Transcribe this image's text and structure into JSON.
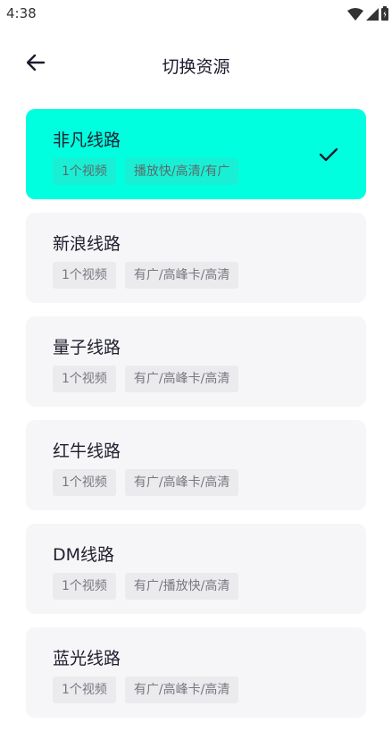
{
  "status_bar": {
    "time": "4:38",
    "icons": [
      "wifi-icon",
      "signal-icon",
      "battery-icon"
    ]
  },
  "header": {
    "title": "切换资源",
    "back_icon": "arrow-left-icon"
  },
  "sources": [
    {
      "name": "非凡线路",
      "count": "1个视频",
      "tags": "播放快/高清/有广",
      "selected": true
    },
    {
      "name": "新浪线路",
      "count": "1个视频",
      "tags": "有广/高峰卡/高清",
      "selected": false
    },
    {
      "name": "量子线路",
      "count": "1个视频",
      "tags": "有广/高峰卡/高清",
      "selected": false
    },
    {
      "name": "红牛线路",
      "count": "1个视频",
      "tags": "有广/高峰卡/高清",
      "selected": false
    },
    {
      "name": "DM线路",
      "count": "1个视频",
      "tags": "有广/播放快/高清",
      "selected": false
    },
    {
      "name": "蓝光线路",
      "count": "1个视频",
      "tags": "有广/高峰卡/高清",
      "selected": false
    }
  ],
  "colors": {
    "selected_bg": "#00ffdf",
    "card_bg": "#f6f6f8",
    "tag_bg": "#ebebee",
    "title_text": "#1b1b2e"
  }
}
